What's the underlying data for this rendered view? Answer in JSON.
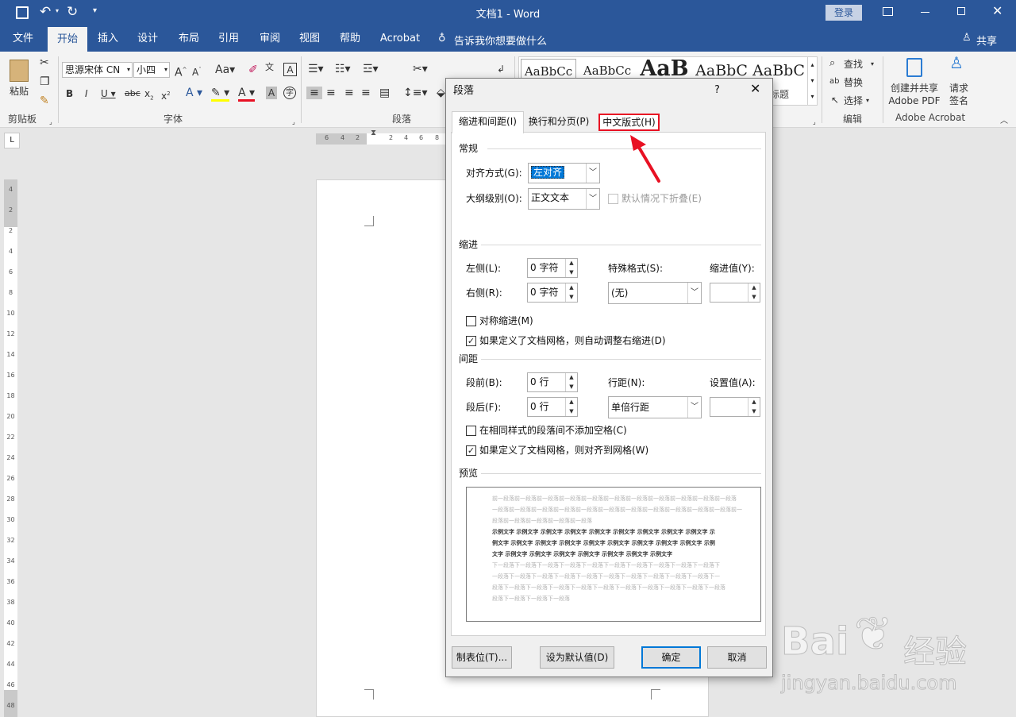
{
  "titlebar": {
    "title": "文档1  -  Word",
    "login": "登录"
  },
  "menu": {
    "tabs": [
      "文件",
      "开始",
      "插入",
      "设计",
      "布局",
      "引用",
      "审阅",
      "视图",
      "帮助",
      "Acrobat"
    ],
    "tell_me": "告诉我你想要做什么",
    "share": "共享"
  },
  "ribbon": {
    "clipboard": {
      "paste": "粘贴",
      "label": "剪贴板"
    },
    "font": {
      "name": "思源宋体 CN",
      "size": "小四",
      "label": "字体"
    },
    "paragraph": {
      "label": "段落"
    },
    "styles": {
      "samples": [
        "AaBbCc",
        "AaBbCc",
        "AaB",
        "AaBbC",
        "AaBbC"
      ],
      "title_fragment": "标题"
    },
    "editing": {
      "find": "查找",
      "replace": "替换",
      "select": "选择",
      "label": "编辑"
    },
    "acrobat": {
      "create": "创建并共享",
      "create2": "Adobe PDF",
      "request": "请求",
      "request2": "签名",
      "label": "Adobe Acrobat"
    }
  },
  "ruler": {
    "horizontal": [
      "6",
      "4",
      "2",
      "2",
      "4",
      "6",
      "8"
    ],
    "vertical": [
      "4",
      "2",
      "2",
      "4",
      "6",
      "8",
      "10",
      "12",
      "14",
      "16",
      "18",
      "20",
      "22",
      "24",
      "26",
      "28",
      "30",
      "32",
      "34",
      "36",
      "38",
      "40",
      "42",
      "44",
      "46",
      "48"
    ]
  },
  "dialog": {
    "title": "段落",
    "help": "?",
    "tabs": [
      "缩进和间距(I)",
      "换行和分页(P)",
      "中文版式(H)"
    ],
    "general": {
      "heading": "常规",
      "alignment_label": "对齐方式(G):",
      "alignment_value": "左对齐",
      "outline_label": "大纲级别(O):",
      "outline_value": "正文文本",
      "collapse_label": "默认情况下折叠(E)"
    },
    "indent": {
      "heading": "缩进",
      "left_label": "左侧(L):",
      "left_value": "0 字符",
      "right_label": "右侧(R):",
      "right_value": "0 字符",
      "special_label": "特殊格式(S):",
      "special_value": "(无)",
      "by_label": "缩进值(Y):",
      "mirror_label": "对称缩进(M)",
      "auto_adjust_label": "如果定义了文档网格，则自动调整右缩进(D)"
    },
    "spacing": {
      "heading": "间距",
      "before_label": "段前(B):",
      "before_value": "0 行",
      "after_label": "段后(F):",
      "after_value": "0 行",
      "line_label": "行距(N):",
      "line_value": "单倍行距",
      "at_label": "设置值(A):",
      "no_space_label": "在相同样式的段落间不添加空格(C)",
      "snap_grid_label": "如果定义了文档网格，则对齐到网格(W)"
    },
    "preview": {
      "heading": "预览",
      "prev_lines": [
        "前一段落前一段落前一段落前一段落前一段落前一段落前一段落前一段落前一段落前一段落前一段落",
        "一段落前一段落前一段落前一段落前一段落前一段落前一段落前一段落前一段落前一段落前一段落前一",
        "段落前一段落前一段落前一段落前一段落"
      ],
      "sample_lines": [
        "示例文字 示例文字 示例文字 示例文字 示例文字 示例文字 示例文字 示例文字 示例文字 示",
        "例文字 示例文字 示例文字 示例文字 示例文字 示例文字 示例文字 示例文字 示例文字 示例",
        "文字 示例文字 示例文字 示例文字 示例文字 示例文字 示例文字 示例文字"
      ],
      "next_lines": [
        "下一段落下一段落下一段落下一段落下一段落下一段落下一段落下一段落下一段落下一段落下",
        "一段落下一段落下一段落下一段落下一段落下一段落下一段落下一段落下一段落下一段落下一",
        "段落下一段落下一段落下一段落下一段落下一段落下一段落下一段落下一段落下一段落下一段落",
        "段落下一段落下一段落下一段落"
      ]
    },
    "buttons": {
      "tabs": "制表位(T)...",
      "set_default": "设为默认值(D)",
      "ok": "确定",
      "cancel": "取消"
    }
  },
  "watermark": {
    "brand": "Bai",
    "brand2": "经验",
    "url": "jingyan.baidu.com"
  },
  "colors": {
    "brand": "#2b579a",
    "highlight": "#e81123",
    "selection": "#0078d7"
  }
}
